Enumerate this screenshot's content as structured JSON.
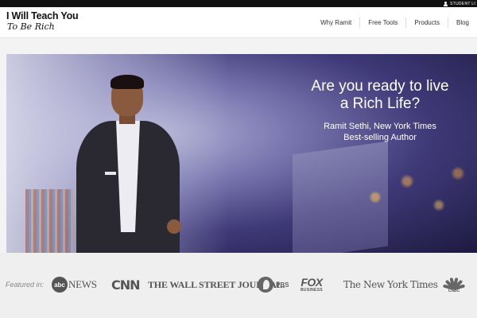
{
  "topbar": {
    "student_login": "STUDENT LOGIN"
  },
  "logo": {
    "line1": "I Will Teach You",
    "line2": "To Be Rich"
  },
  "nav": {
    "items": [
      "Why Ramit",
      "Free Tools",
      "Products",
      "Blog"
    ]
  },
  "hero": {
    "headline_line1": "Are you ready to live",
    "headline_line2": "a Rich Life?",
    "byline_line1": "Ramit Sethi, New York Times",
    "byline_line2": "Best-selling Author"
  },
  "featured": {
    "label": "Featured in:",
    "brands": {
      "abc_mark": "abc",
      "abc_word": "NEWS",
      "cnn": "CNN",
      "wsj": "THE WALL STREET JOURNAL.",
      "pbs": "PBS",
      "fox_top": "FOX",
      "fox_bottom": "BUSINESS",
      "nyt": "The New York Times",
      "cnbc": "CNBC"
    }
  },
  "icons": [
    "user-icon",
    "nbc-peacock-icon",
    "pbs-head-icon"
  ]
}
